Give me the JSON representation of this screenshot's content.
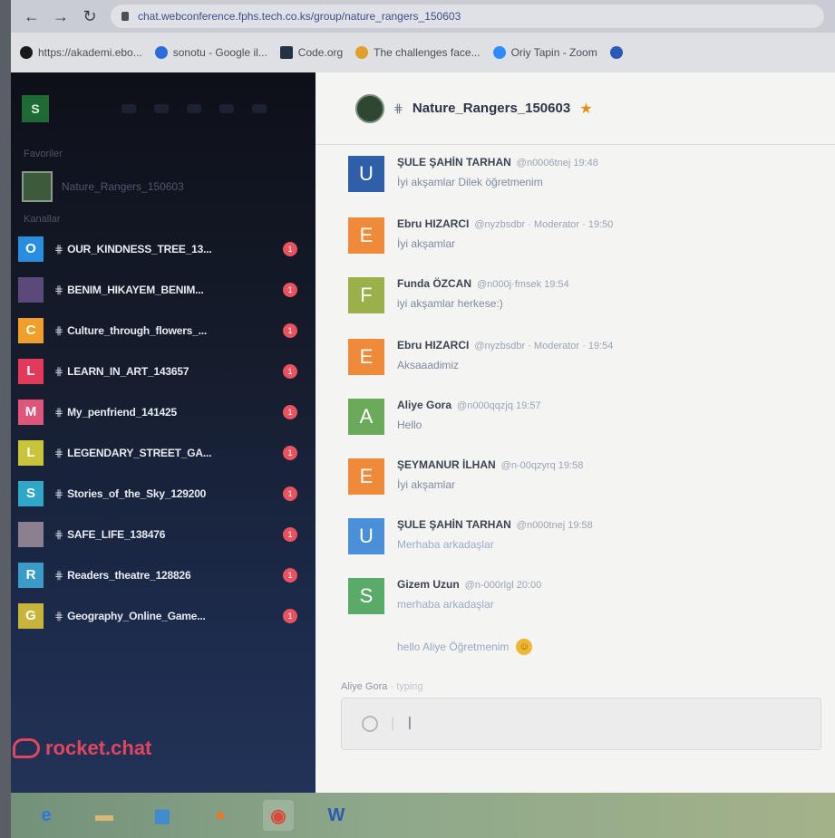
{
  "browser": {
    "address": "chat.webconference.fphs.tech.co.ks/group/nature_rangers_150603",
    "back_glyph": "←",
    "forward_glyph": "→",
    "reload_glyph": "↻",
    "bookmarks": [
      {
        "label": "https://akademi.ebo...",
        "color": "#1a1a1a"
      },
      {
        "label": "sonotu - Google il...",
        "color": "#2b6bdc"
      },
      {
        "label": "Code.org",
        "color": "#234"
      },
      {
        "label": "The challenges face...",
        "color": "#e0a02a"
      },
      {
        "label": "Oriy Tapin - Zoom",
        "color": "#2d8cff"
      }
    ]
  },
  "sidebar": {
    "user_initial": "S",
    "favorites_heading": "Favoriler",
    "favorite": {
      "label": "Nature_Rangers_150603"
    },
    "channels_heading": "Kanallar",
    "channels": [
      {
        "initial": "O",
        "name": "OUR_KINDNESS_TREE_13...",
        "color": "#2a8ee0",
        "badge": "1"
      },
      {
        "initial": "",
        "name": "BENIM_HIKAYEM_BENIM...",
        "color": "#5a4a7a",
        "badge": "1"
      },
      {
        "initial": "C",
        "name": "Culture_through_flowers_...",
        "color": "#f0a02a",
        "badge": "1"
      },
      {
        "initial": "L",
        "name": "LEARN_IN_ART_143657",
        "color": "#e23a5a",
        "badge": "1"
      },
      {
        "initial": "M",
        "name": "My_penfriend_141425",
        "color": "#e0557a",
        "badge": "1"
      },
      {
        "initial": "L",
        "name": "LEGENDARY_STREET_GA...",
        "color": "#c9c43a",
        "badge": "1"
      },
      {
        "initial": "S",
        "name": "Stories_of_the_Sky_129200",
        "color": "#2fa8c8",
        "badge": "1"
      },
      {
        "initial": "",
        "name": "SAFE_LIFE_138476",
        "color": "#8a8090",
        "badge": "1"
      },
      {
        "initial": "R",
        "name": "Readers_theatre_128826",
        "color": "#3a9ac8",
        "badge": "1"
      },
      {
        "initial": "G",
        "name": "Geography_Online_Game...",
        "color": "#c8b43a",
        "badge": "1"
      }
    ],
    "brand": "rocket.chat"
  },
  "room": {
    "title": "Nature_Rangers_150603",
    "star": "★"
  },
  "messages": [
    {
      "initial": "U",
      "color": "#2f5fa8",
      "user": "ŞULE ŞAHİN TARHAN",
      "meta": "@n0006tnej 19:48",
      "text": "İyi akşamlar Dilek öğretmenim"
    },
    {
      "initial": "E",
      "color": "#ef8a3a",
      "user": "Ebru HIZARCI",
      "meta": "@nyzbsdbr · Moderator · 19:50",
      "text": "İyi akşamlar"
    },
    {
      "initial": "F",
      "color": "#9ab04a",
      "user": "Funda ÖZCAN",
      "meta": "@n000j·fmsek 19:54",
      "text": "iyi akşamlar herkese:)"
    },
    {
      "initial": "E",
      "color": "#ef8a3a",
      "user": "Ebru HIZARCI",
      "meta": "@nyzbsdbr · Moderator · 19:54",
      "text": "Aksaaadimiz"
    },
    {
      "initial": "A",
      "color": "#6aaa5a",
      "user": "Aliye Gora",
      "meta": "@n000qqzjq 19:57",
      "text": "Hello"
    },
    {
      "initial": "E",
      "color": "#ef8a3a",
      "user": "ŞEYMANUR İLHAN",
      "meta": "@n-00qzyrq 19:58",
      "text": "İyi akşamlar"
    },
    {
      "initial": "U",
      "color": "#4a90d8",
      "user": "ŞULE ŞAHİN TARHAN",
      "meta": "@n000tnej 19:58",
      "text": "Merhaba arkadaşlar"
    },
    {
      "initial": "S",
      "color": "#5aaa6a",
      "user": "Gizem Uzun",
      "meta": "@n-000rlgl 20:00",
      "text": "merhaba arkadaşlar"
    }
  ],
  "extra_message": {
    "text": "hello Aliye Öğretmenim",
    "emoji": "☺"
  },
  "typing": {
    "name": "Aliye Gora",
    "suffix": "· typing"
  },
  "composer": {
    "caret": "I"
  },
  "taskbar": [
    {
      "glyph": "e",
      "color": "#2a7ad8"
    },
    {
      "glyph": "▬",
      "color": "#d8b878"
    },
    {
      "glyph": "▦",
      "color": "#3a8ad8"
    },
    {
      "glyph": "●",
      "color": "#e27a2a"
    },
    {
      "glyph": "◉",
      "color": "#d84a3a"
    },
    {
      "glyph": "W",
      "color": "#2a5ab8"
    }
  ]
}
